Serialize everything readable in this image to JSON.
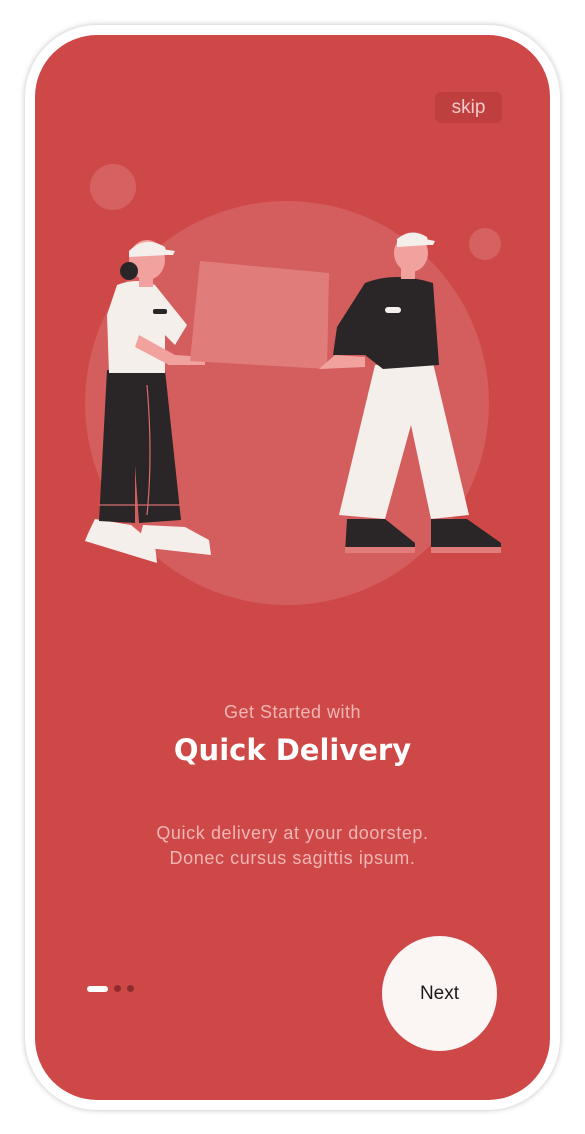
{
  "header": {
    "skip_label": "skip"
  },
  "onboarding": {
    "subtitle": "Get Started with",
    "title": "Quick Delivery",
    "description_line1": "Quick delivery at your doorstep.",
    "description_line2": "Donec cursus sagittis ipsum.",
    "current_page": 1,
    "total_pages": 3
  },
  "footer": {
    "next_label": "Next"
  },
  "colors": {
    "background": "#cf4848",
    "accent_light": "#fbf5f4",
    "dark": "#2a2627"
  },
  "icons": [
    "delivery-illustration"
  ]
}
